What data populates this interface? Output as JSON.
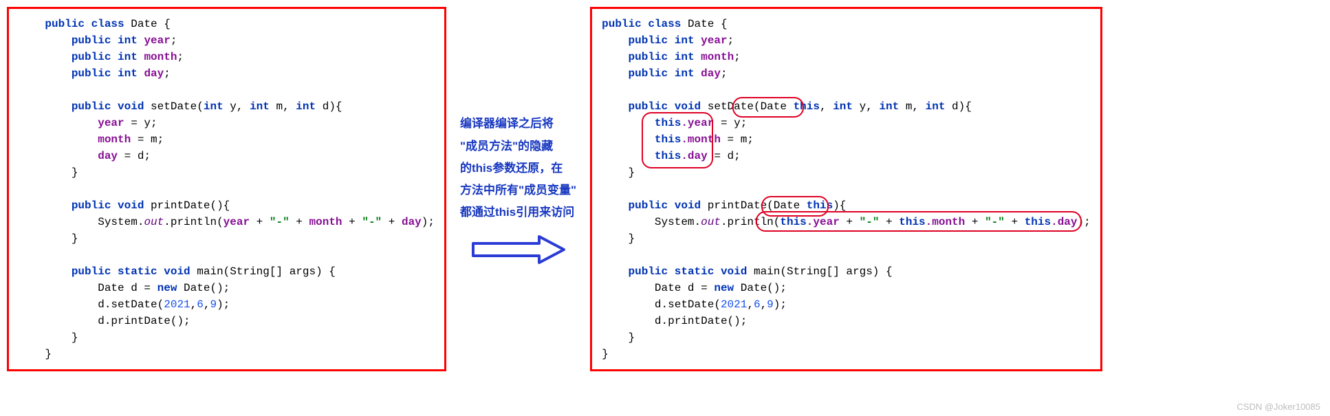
{
  "left": {
    "l1": "public",
    "l2": "class",
    "l3": "Date",
    "l4": "{",
    "f1a": "public",
    "f1b": "int",
    "f1c": "year",
    "f1d": ";",
    "f2a": "public",
    "f2b": "int",
    "f2c": "month",
    "f2d": ";",
    "f3a": "public",
    "f3b": "int",
    "f3c": "day",
    "f3d": ";",
    "m1a": "public",
    "m1b": "void",
    "m1c": "setDate(",
    "m1d": "int",
    "m1e": " y, ",
    "m1f": "int",
    "m1g": " m, ",
    "m1h": "int",
    "m1i": " d){",
    "b1a": "year",
    "b1b": " = y;",
    "b2a": "month",
    "b2b": " = m;",
    "b3a": "day",
    "b3b": " = d;",
    "rc": "}",
    "p1a": "public",
    "p1b": "void",
    "p1c": "printDate(){",
    "pr1": "System.",
    "pr2": "out",
    "pr3": ".println(",
    "pr4": "year",
    "pr5": " + ",
    "pr6": "\"-\"",
    "pr7": " + ",
    "pr8": "month",
    "pr9": " + ",
    "pr10": "\"-\"",
    "pr11": " + ",
    "pr12": "day",
    "pr13": ");",
    "mn1": "public",
    "mn2": "static",
    "mn3": "void",
    "mn4": "main(String[] args) {",
    "mnl1": "Date d = ",
    "mnl1b": "new",
    "mnl1c": " Date();",
    "mnl2a": "d.setDate(",
    "mnl2b": "2021",
    "mnl2c": ",",
    "mnl2d": "6",
    "mnl2e": ",",
    "mnl2f": "9",
    "mnl2g": ");",
    "mnl3": "d.printDate();"
  },
  "mid": {
    "line1": "编译器编译之后将",
    "line2": "\"成员方法\"的隐藏",
    "line3": "的this参数还原，在",
    "line4": "方法中所有\"成员变量\"",
    "line5": "都通过this引用来访问"
  },
  "right": {
    "l1": "public",
    "l2": "class",
    "l3": "Date",
    "l4": "{",
    "f1a": "public",
    "f1b": "int",
    "f1c": "year",
    "f1d": ";",
    "f2a": "public",
    "f2b": "int",
    "f2c": "month",
    "f2d": ";",
    "f3a": "public",
    "f3b": "int",
    "f3c": "day",
    "f3d": ";",
    "m1a": "public",
    "m1b": "void",
    "m1c": "setDate(",
    "m1p": "Date ",
    "m1t": "this",
    "m1cm": ", ",
    "m1d": "int",
    "m1e": " y, ",
    "m1f": "int",
    "m1g": " m, ",
    "m1h": "int",
    "m1i": " d){",
    "b1t": "this",
    "b1a": ".year",
    "b1b": " = y;",
    "b2t": "this",
    "b2a": ".month",
    "b2b": " = m;",
    "b3t": "this",
    "b3a": ".day",
    "b3b": " = d;",
    "rc": "}",
    "p1a": "public",
    "p1b": "void",
    "p1c": "printDate(",
    "p1p": "Date ",
    "p1t": "this",
    "p1e": "){",
    "pr1": "System.",
    "pr2": "out",
    "pr3": ".println(",
    "prt1": "this",
    "pr4": ".year",
    "pr5": " + ",
    "pr6": "\"-\"",
    "pr7": " + ",
    "prt2": "this",
    "pr8": ".month",
    "pr9": " + ",
    "pr10": "\"-\"",
    "pr11": " + ",
    "prt3": "this",
    "pr12": ".day",
    "pr13": ");",
    "mn1": "public",
    "mn2": "static",
    "mn3": "void",
    "mn4": "main(String[] args) {",
    "mnl1": "Date d = ",
    "mnl1b": "new",
    "mnl1c": " Date();",
    "mnl2a": "d.setDate(",
    "mnl2b": "2021",
    "mnl2c": ",",
    "mnl2d": "6",
    "mnl2e": ",",
    "mnl2f": "9",
    "mnl2g": ");",
    "mnl3": "d.printDate();"
  },
  "watermark": "CSDN @Joker10085"
}
